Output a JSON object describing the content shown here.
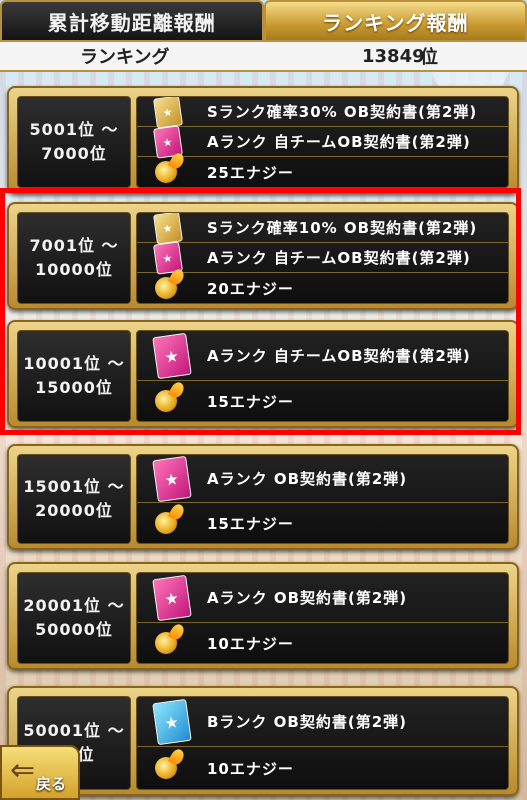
{
  "tabs": [
    {
      "label": "累計移動距離報酬",
      "active": false
    },
    {
      "label": "ランキング報酬",
      "active": true
    }
  ],
  "ranking": {
    "label": "ランキング",
    "value": "13849",
    "unit": "位"
  },
  "tiers": [
    {
      "range": [
        "5001位 ～",
        "7000位"
      ],
      "rewards": [
        {
          "icon": "gold-contract-icon",
          "text": "Sランク確率30% OB契約書(第2弾)"
        },
        {
          "icon": "pink-contract-icon",
          "text": "Aランク 自チームOB契約書(第2弾)"
        },
        {
          "icon": "energy-icon",
          "text": "25エナジー"
        }
      ]
    },
    {
      "range": [
        "7001位 ～",
        "10000位"
      ],
      "rewards": [
        {
          "icon": "gold-contract-icon",
          "text": "Sランク確率10% OB契約書(第2弾)"
        },
        {
          "icon": "pink-contract-icon",
          "text": "Aランク 自チームOB契約書(第2弾)"
        },
        {
          "icon": "energy-icon",
          "text": "20エナジー"
        }
      ]
    },
    {
      "range": [
        "10001位 ～",
        "15000位"
      ],
      "rewards": [
        {
          "icon": "pink-contract-icon",
          "text": "Aランク 自チームOB契約書(第2弾)"
        },
        {
          "icon": "energy-icon",
          "text": "15エナジー"
        }
      ]
    },
    {
      "range": [
        "15001位 ～",
        "20000位"
      ],
      "rewards": [
        {
          "icon": "pink-contract-icon",
          "text": "Aランク OB契約書(第2弾)"
        },
        {
          "icon": "energy-icon",
          "text": "15エナジー"
        }
      ]
    },
    {
      "range": [
        "20001位 ～",
        "50000位"
      ],
      "rewards": [
        {
          "icon": "pink-contract-icon",
          "text": "Aランク OB契約書(第2弾)"
        },
        {
          "icon": "energy-icon",
          "text": "10エナジー"
        }
      ]
    },
    {
      "range": [
        "50001位 ～",
        "00位"
      ],
      "rewards": [
        {
          "icon": "blue-contract-icon",
          "text": "Bランク OB契約書(第2弾)"
        },
        {
          "icon": "energy-icon",
          "text": "10エナジー"
        }
      ]
    }
  ],
  "back_button": {
    "label": "戻る",
    "icon": "back-arrow-icon"
  },
  "colors": {
    "highlight": "#ff0000",
    "gold": "#c99a30"
  }
}
